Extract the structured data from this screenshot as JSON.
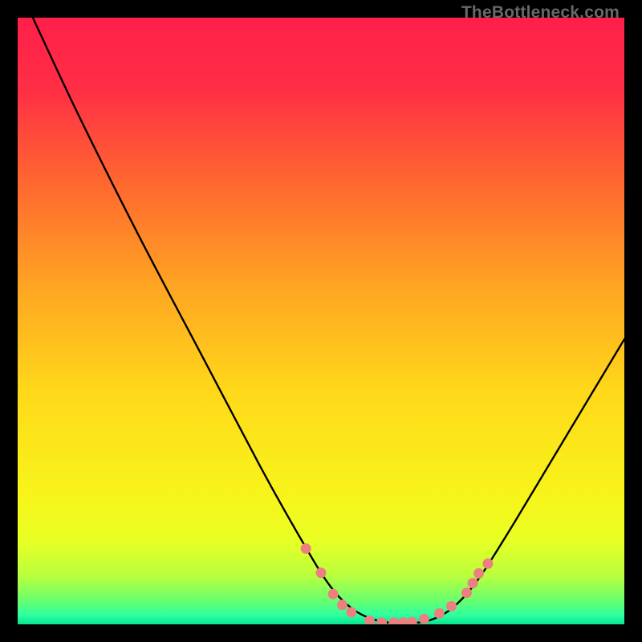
{
  "watermark": "TheBottleneck.com",
  "colors": {
    "gradient_stops": [
      {
        "offset": 0.0,
        "color": "#ff1f4a"
      },
      {
        "offset": 0.12,
        "color": "#ff2f45"
      },
      {
        "offset": 0.28,
        "color": "#ff6a2f"
      },
      {
        "offset": 0.45,
        "color": "#ffa722"
      },
      {
        "offset": 0.62,
        "color": "#ffd91a"
      },
      {
        "offset": 0.78,
        "color": "#f8f31a"
      },
      {
        "offset": 0.86,
        "color": "#eaff24"
      },
      {
        "offset": 0.92,
        "color": "#b9ff3e"
      },
      {
        "offset": 0.96,
        "color": "#6aff6e"
      },
      {
        "offset": 0.985,
        "color": "#2dffa0"
      },
      {
        "offset": 1.0,
        "color": "#06e58f"
      }
    ],
    "curve": "#000000",
    "dot_fill": "#ec8080",
    "background": "#000000"
  },
  "chart_data": {
    "type": "line",
    "title": "",
    "xlabel": "",
    "ylabel": "",
    "xlim": [
      0,
      100
    ],
    "ylim": [
      0,
      100
    ],
    "grid": false,
    "legend": false,
    "series": [
      {
        "name": "bottleneck-curve",
        "x": [
          2.5,
          10,
          20,
          30,
          40,
          45,
          50,
          53,
          56,
          59,
          62,
          65,
          68,
          71,
          74,
          77,
          82,
          88,
          94,
          100
        ],
        "y": [
          100,
          84,
          64,
          45,
          26,
          17,
          8.5,
          4.5,
          2.0,
          0.7,
          0.2,
          0.2,
          0.7,
          2.2,
          5.0,
          9.0,
          17,
          27,
          37,
          47
        ]
      }
    ],
    "dots": {
      "name": "scatter-dots",
      "x": [
        47.5,
        50.0,
        52.0,
        53.5,
        55.0,
        58.0,
        60.0,
        62.0,
        63.5,
        65.0,
        67.0,
        69.5,
        71.5,
        74.0,
        75.0,
        76.0,
        77.5
      ],
      "y": [
        12.5,
        8.5,
        5.0,
        3.2,
        2.0,
        0.6,
        0.3,
        0.3,
        0.3,
        0.4,
        0.9,
        1.8,
        3.0,
        5.2,
        6.8,
        8.4,
        10.0
      ]
    }
  }
}
